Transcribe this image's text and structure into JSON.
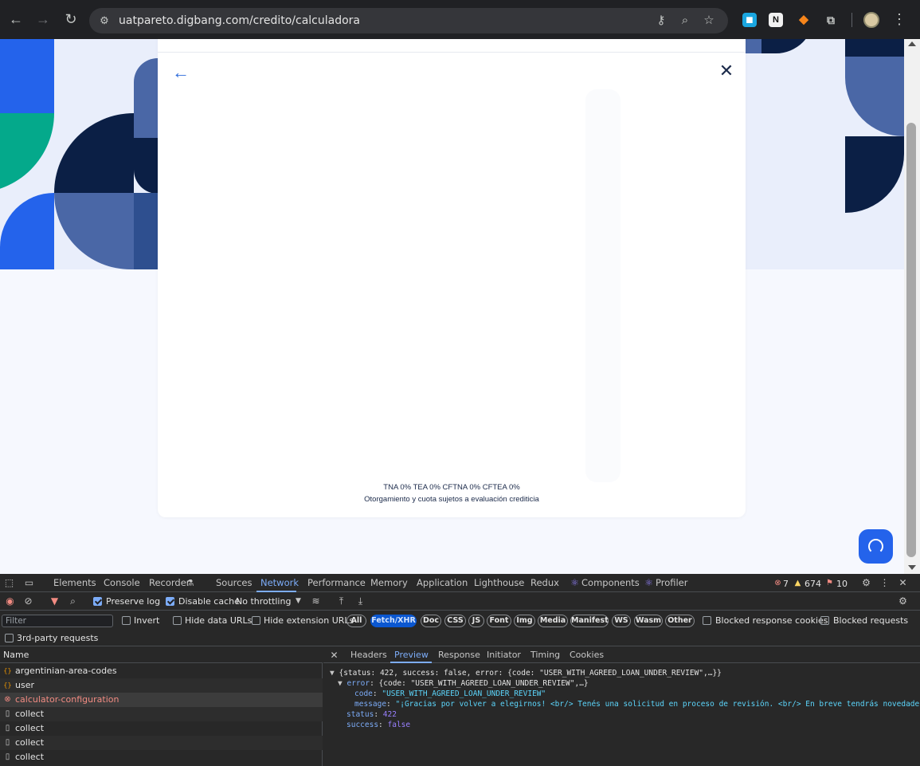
{
  "browser": {
    "url": "uatpareto.digbang.com/credito/calculadora",
    "extensions": [
      "extension-blue-icon",
      "notion-icon",
      "metamask-icon",
      "puzzle-extensions-icon"
    ]
  },
  "page": {
    "modal": {
      "rates": "TNA 0% TEA 0% CFTNA 0% CFTEA 0%",
      "disclaimer": "Otorgamiento y cuota sujetos a evaluación crediticia"
    },
    "colors": {
      "navy": "#0b1f45",
      "blue": "#2463eb",
      "steel": "#4a67a6",
      "teal": "#04a98b",
      "hero_bg": "#e9eefb"
    }
  },
  "devtools": {
    "tabs": [
      "Elements",
      "Console",
      "Recorder",
      "Sources",
      "Network",
      "Performance",
      "Memory",
      "Application",
      "Lighthouse",
      "Redux",
      "Components",
      "Profiler"
    ],
    "active_tab": "Network",
    "counts": {
      "errors": "7",
      "warnings": "674",
      "issues": "10"
    },
    "toolbar": {
      "preserve_log": "Preserve log",
      "disable_cache": "Disable cache",
      "throttling": "No throttling"
    },
    "filter": {
      "placeholder": "Filter",
      "invert": "Invert",
      "hide_data_urls": "Hide data URLs",
      "hide_extension_urls": "Hide extension URLs",
      "types": [
        "All",
        "Fetch/XHR",
        "Doc",
        "CSS",
        "JS",
        "Font",
        "Img",
        "Media",
        "Manifest",
        "WS",
        "Wasm",
        "Other"
      ],
      "active_type": "Fetch/XHR",
      "blocked_response_cookies": "Blocked response cookies",
      "blocked_requests": "Blocked requests",
      "third_party": "3rd-party requests"
    },
    "requests": {
      "header": "Name",
      "rows": [
        {
          "name": "argentinian-area-codes",
          "type": "fetch",
          "selected": false
        },
        {
          "name": "user",
          "type": "fetch",
          "selected": false
        },
        {
          "name": "calculator-configuration",
          "type": "error",
          "selected": true
        },
        {
          "name": "collect",
          "type": "doc",
          "selected": false
        },
        {
          "name": "collect",
          "type": "doc",
          "selected": false
        },
        {
          "name": "collect",
          "type": "doc",
          "selected": false
        },
        {
          "name": "collect",
          "type": "doc",
          "selected": false
        }
      ]
    },
    "detail": {
      "tabs": [
        "Headers",
        "Preview",
        "Response",
        "Initiator",
        "Timing",
        "Cookies"
      ],
      "active_tab": "Preview",
      "preview": {
        "summary": "{status: 422, success: false, error: {code: \"USER_WITH_AGREED_LOAN_UNDER_REVIEW\",…}}",
        "error_key": "error",
        "error_summary": "{code: \"USER_WITH_AGREED_LOAN_UNDER_REVIEW\",…}",
        "code_key": "code",
        "code_value": "\"USER_WITH_AGREED_LOAN_UNDER_REVIEW\"",
        "message_key": "message",
        "message_value": "\"¡Gracias por volver a elegirnos! <br/> Tenés una solicitud en proceso de revisión. <br/> En breve tendrás novedade",
        "status_key": "status",
        "status_value": "422",
        "success_key": "success",
        "success_value": "false"
      }
    }
  }
}
